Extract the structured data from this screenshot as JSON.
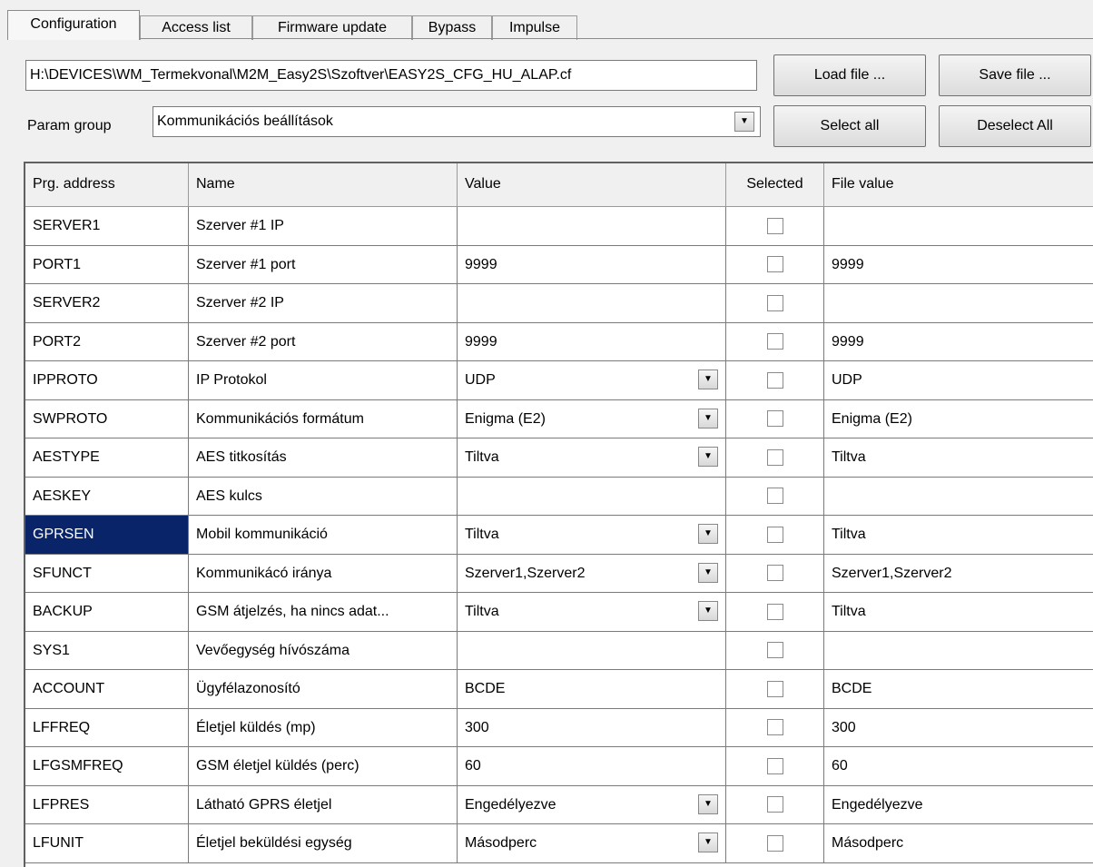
{
  "tabs": [
    "Configuration",
    "Access list",
    "Firmware update",
    "Bypass",
    "Impulse"
  ],
  "toolbar": {
    "file_path": "H:\\DEVICES\\WM_Termekvonal\\M2M_Easy2S\\Szoftver\\EASY2S_CFG_HU_ALAP.cf",
    "load_label": "Load file ...",
    "save_label": "Save file ...",
    "param_group_label": "Param group",
    "param_group_value": "Kommunikációs beállítások",
    "select_all_label": "Select all",
    "deselect_all_label": "Deselect All"
  },
  "grid": {
    "columns": [
      "Prg. address",
      "Name",
      "Value",
      "Selected",
      "File value"
    ],
    "rows": [
      {
        "address": "SERVER1",
        "name": "Szerver #1 IP",
        "value": "",
        "dropdown": false,
        "file_value": ""
      },
      {
        "address": "PORT1",
        "name": "Szerver #1 port",
        "value": "9999",
        "dropdown": false,
        "file_value": "9999"
      },
      {
        "address": "SERVER2",
        "name": "Szerver #2 IP",
        "value": "",
        "dropdown": false,
        "file_value": ""
      },
      {
        "address": "PORT2",
        "name": "Szerver #2 port",
        "value": "9999",
        "dropdown": false,
        "file_value": "9999"
      },
      {
        "address": "IPPROTO",
        "name": "IP Protokol",
        "value": "UDP",
        "dropdown": true,
        "file_value": "UDP"
      },
      {
        "address": "SWPROTO",
        "name": "Kommunikációs formátum",
        "value": "Enigma (E2)",
        "dropdown": true,
        "file_value": "Enigma (E2)"
      },
      {
        "address": "AESTYPE",
        "name": "AES titkosítás",
        "value": "Tiltva",
        "dropdown": true,
        "file_value": "Tiltva"
      },
      {
        "address": "AESKEY",
        "name": "AES kulcs",
        "value": "",
        "dropdown": false,
        "file_value": ""
      },
      {
        "address": "GPRSEN",
        "name": "Mobil kommunikáció",
        "value": "Tiltva",
        "dropdown": true,
        "file_value": "Tiltva",
        "highlighted": true
      },
      {
        "address": "SFUNCT",
        "name": "Kommunikácó iránya",
        "value": "Szerver1,Szerver2",
        "dropdown": true,
        "file_value": "Szerver1,Szerver2"
      },
      {
        "address": "BACKUP",
        "name": "GSM átjelzés, ha nincs adat...",
        "value": "Tiltva",
        "dropdown": true,
        "file_value": "Tiltva"
      },
      {
        "address": "SYS1",
        "name": "Vevőegység hívószáma",
        "value": "",
        "dropdown": false,
        "file_value": ""
      },
      {
        "address": "ACCOUNT",
        "name": "Ügyfélazonosító",
        "value": "BCDE",
        "dropdown": false,
        "file_value": "BCDE"
      },
      {
        "address": "LFFREQ",
        "name": "Életjel küldés (mp)",
        "value": "300",
        "dropdown": false,
        "file_value": "300"
      },
      {
        "address": "LFGSMFREQ",
        "name": "GSM életjel küldés (perc)",
        "value": "60",
        "dropdown": false,
        "file_value": "60"
      },
      {
        "address": "LFPRES",
        "name": "Látható GPRS életjel",
        "value": "Engedélyezve",
        "dropdown": true,
        "file_value": "Engedélyezve"
      },
      {
        "address": "LFUNIT",
        "name": "Életjel beküldési egység",
        "value": "Másodperc",
        "dropdown": true,
        "file_value": "Másodperc"
      }
    ]
  },
  "colors": {
    "selection": "#0a246a"
  },
  "icons": {
    "dropdown": "chevron-down-icon",
    "checkbox": "checkbox"
  }
}
